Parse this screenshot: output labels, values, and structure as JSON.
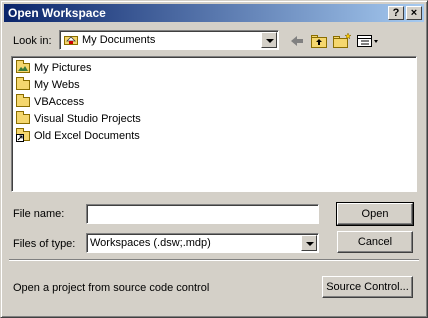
{
  "window": {
    "title": "Open Workspace"
  },
  "titlebar": {
    "help_label": "?",
    "close_label": "×"
  },
  "look_in": {
    "label": "Look in:",
    "value": "My Documents",
    "icon": "folder-home-icon"
  },
  "toolbar": {
    "back_icon": "back-arrow-icon",
    "up_icon": "up-folder-icon",
    "new_folder_icon": "new-folder-icon",
    "view_icon": "view-menu-icon"
  },
  "files": [
    {
      "name": "My Pictures",
      "icon": "pictures-folder-icon"
    },
    {
      "name": "My Webs",
      "icon": "folder-icon"
    },
    {
      "name": "VBAccess",
      "icon": "folder-icon"
    },
    {
      "name": "Visual Studio Projects",
      "icon": "folder-icon"
    },
    {
      "name": "Old Excel Documents",
      "icon": "shortcut-folder-icon"
    }
  ],
  "file_name": {
    "label": "File name:",
    "value": ""
  },
  "file_type": {
    "label": "Files of type:",
    "value": "Workspaces (.dsw;.mdp)"
  },
  "buttons": {
    "open": "Open",
    "cancel": "Cancel",
    "source_control": "Source Control..."
  },
  "status": {
    "text": "Open a project from source code control"
  }
}
